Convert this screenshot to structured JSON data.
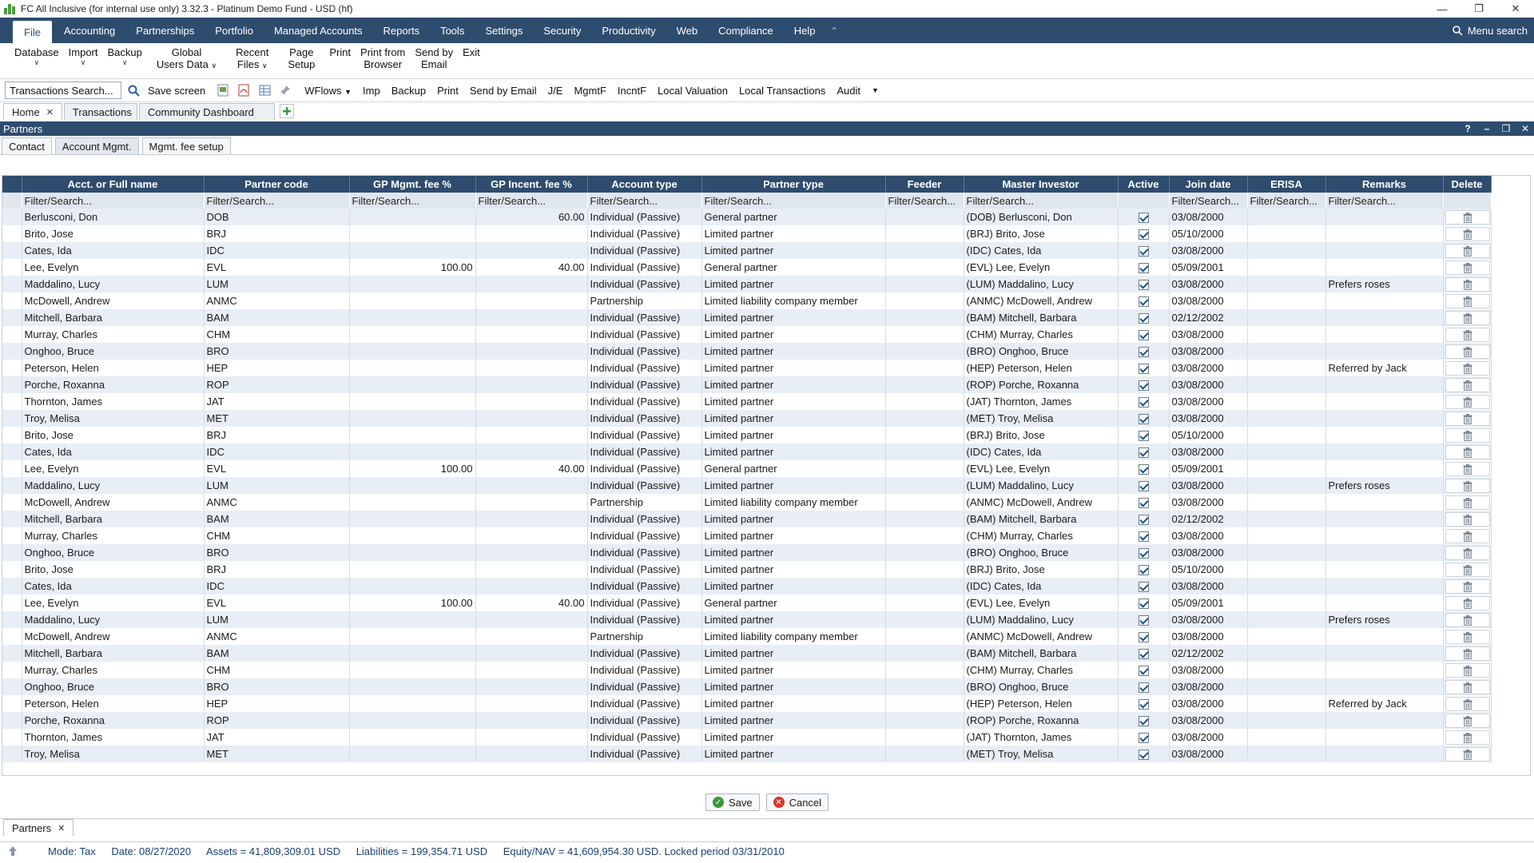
{
  "window": {
    "title": "FC All Inclusive (for internal use only) 3.32.3 - Platinum Demo Fund - USD (hf)",
    "controls": [
      "—",
      "❐",
      "✕"
    ]
  },
  "menu": {
    "items": [
      "File",
      "Accounting",
      "Partnerships",
      "Portfolio",
      "Managed Accounts",
      "Reports",
      "Tools",
      "Settings",
      "Security",
      "Productivity",
      "Web",
      "Compliance",
      "Help"
    ],
    "search_label": "Menu search"
  },
  "ribbon": {
    "items": [
      {
        "label": "Database",
        "dropdown": true
      },
      {
        "label": "Import",
        "dropdown": true
      },
      {
        "label": "Backup",
        "dropdown": true
      },
      {
        "label": "Global\nUsers Data",
        "dropdown": true
      },
      {
        "label": "Recent\nFiles",
        "dropdown": true
      },
      {
        "label": "Page\nSetup",
        "dropdown": false
      },
      {
        "label": "Print",
        "dropdown": false
      },
      {
        "label": "Print from\nBrowser",
        "dropdown": false
      },
      {
        "label": "Send by\nEmail",
        "dropdown": false
      },
      {
        "label": "Exit",
        "dropdown": false
      }
    ]
  },
  "toolbar": {
    "search_value": "Transactions Search...",
    "save_screen": "Save screen",
    "wflows": "WFlows",
    "buttons": [
      "Imp",
      "Backup",
      "Print",
      "Send by Email",
      "J/E",
      "MgmtF",
      "IncntF",
      "Local Valuation",
      "Local Transactions",
      "Audit"
    ]
  },
  "doc_tabs": [
    {
      "label": "Home",
      "closable": true,
      "active": true
    },
    {
      "label": "Transactions",
      "closable": false,
      "active": false
    },
    {
      "label": "Community Dashboard",
      "closable": false,
      "active": false
    }
  ],
  "panel": {
    "title": "Partners",
    "controls": [
      "?",
      "–",
      "❐",
      "✕"
    ]
  },
  "sub_tabs": [
    "Contact",
    "Account Mgmt.",
    "Mgmt. fee setup"
  ],
  "grid": {
    "columns": [
      "",
      "Acct. or Full name",
      "Partner code",
      "GP Mgmt. fee %",
      "GP Incent. fee %",
      "Account type",
      "Partner type",
      "Feeder",
      "Master Investor",
      "Active",
      "Join date",
      "ERISA",
      "Remarks",
      "Delete"
    ],
    "filter_placeholder": "Filter/Search...",
    "rows": [
      [
        "Berlusconi, Don",
        "DOB",
        "",
        "60.00",
        "Individual (Passive)",
        "General partner",
        "",
        "(DOB) Berlusconi, Don",
        "03/08/2000",
        "",
        ""
      ],
      [
        "Brito, Jose",
        "BRJ",
        "",
        "",
        "Individual (Passive)",
        "Limited partner",
        "",
        "(BRJ) Brito, Jose",
        "05/10/2000",
        "",
        ""
      ],
      [
        "Cates, Ida",
        "IDC",
        "",
        "",
        "Individual (Passive)",
        "Limited partner",
        "",
        "(IDC) Cates, Ida",
        "03/08/2000",
        "",
        ""
      ],
      [
        "Lee, Evelyn",
        "EVL",
        "100.00",
        "40.00",
        "Individual (Passive)",
        "General partner",
        "",
        "(EVL) Lee, Evelyn",
        "05/09/2001",
        "",
        ""
      ],
      [
        "Maddalino, Lucy",
        "LUM",
        "",
        "",
        "Individual (Passive)",
        "Limited partner",
        "",
        "(LUM) Maddalino, Lucy",
        "03/08/2000",
        "",
        "Prefers roses"
      ],
      [
        "McDowell, Andrew",
        "ANMC",
        "",
        "",
        "Partnership",
        "Limited liability company member",
        "",
        "(ANMC) McDowell, Andrew",
        "03/08/2000",
        "",
        ""
      ],
      [
        "Mitchell, Barbara",
        "BAM",
        "",
        "",
        "Individual (Passive)",
        "Limited partner",
        "",
        "(BAM) Mitchell, Barbara",
        "02/12/2002",
        "",
        ""
      ],
      [
        "Murray, Charles",
        "CHM",
        "",
        "",
        "Individual (Passive)",
        "Limited partner",
        "",
        "(CHM) Murray, Charles",
        "03/08/2000",
        "",
        ""
      ],
      [
        "Onghoo, Bruce",
        "BRO",
        "",
        "",
        "Individual (Passive)",
        "Limited partner",
        "",
        "(BRO) Onghoo, Bruce",
        "03/08/2000",
        "",
        ""
      ],
      [
        "Peterson, Helen",
        "HEP",
        "",
        "",
        "Individual (Passive)",
        "Limited partner",
        "",
        "(HEP) Peterson, Helen",
        "03/08/2000",
        "",
        "Referred by Jack"
      ],
      [
        "Porche, Roxanna",
        "ROP",
        "",
        "",
        "Individual (Passive)",
        "Limited partner",
        "",
        "(ROP) Porche, Roxanna",
        "03/08/2000",
        "",
        ""
      ],
      [
        "Thornton, James",
        "JAT",
        "",
        "",
        "Individual (Passive)",
        "Limited partner",
        "",
        "(JAT) Thornton, James",
        "03/08/2000",
        "",
        ""
      ],
      [
        "Troy, Melisa",
        "MET",
        "",
        "",
        "Individual (Passive)",
        "Limited partner",
        "",
        "(MET) Troy, Melisa",
        "03/08/2000",
        "",
        ""
      ],
      [
        "Brito, Jose",
        "BRJ",
        "",
        "",
        "Individual (Passive)",
        "Limited partner",
        "",
        "(BRJ) Brito, Jose",
        "05/10/2000",
        "",
        ""
      ],
      [
        "Cates, Ida",
        "IDC",
        "",
        "",
        "Individual (Passive)",
        "Limited partner",
        "",
        "(IDC) Cates, Ida",
        "03/08/2000",
        "",
        ""
      ],
      [
        "Lee, Evelyn",
        "EVL",
        "100.00",
        "40.00",
        "Individual (Passive)",
        "General partner",
        "",
        "(EVL) Lee, Evelyn",
        "05/09/2001",
        "",
        ""
      ],
      [
        "Maddalino, Lucy",
        "LUM",
        "",
        "",
        "Individual (Passive)",
        "Limited partner",
        "",
        "(LUM) Maddalino, Lucy",
        "03/08/2000",
        "",
        "Prefers roses"
      ],
      [
        "McDowell, Andrew",
        "ANMC",
        "",
        "",
        "Partnership",
        "Limited liability company member",
        "",
        "(ANMC) McDowell, Andrew",
        "03/08/2000",
        "",
        ""
      ],
      [
        "Mitchell, Barbara",
        "BAM",
        "",
        "",
        "Individual (Passive)",
        "Limited partner",
        "",
        "(BAM) Mitchell, Barbara",
        "02/12/2002",
        "",
        ""
      ],
      [
        "Murray, Charles",
        "CHM",
        "",
        "",
        "Individual (Passive)",
        "Limited partner",
        "",
        "(CHM) Murray, Charles",
        "03/08/2000",
        "",
        ""
      ],
      [
        "Onghoo, Bruce",
        "BRO",
        "",
        "",
        "Individual (Passive)",
        "Limited partner",
        "",
        "(BRO) Onghoo, Bruce",
        "03/08/2000",
        "",
        ""
      ],
      [
        "Brito, Jose",
        "BRJ",
        "",
        "",
        "Individual (Passive)",
        "Limited partner",
        "",
        "(BRJ) Brito, Jose",
        "05/10/2000",
        "",
        ""
      ],
      [
        "Cates, Ida",
        "IDC",
        "",
        "",
        "Individual (Passive)",
        "Limited partner",
        "",
        "(IDC) Cates, Ida",
        "03/08/2000",
        "",
        ""
      ],
      [
        "Lee, Evelyn",
        "EVL",
        "100.00",
        "40.00",
        "Individual (Passive)",
        "General partner",
        "",
        "(EVL) Lee, Evelyn",
        "05/09/2001",
        "",
        ""
      ],
      [
        "Maddalino, Lucy",
        "LUM",
        "",
        "",
        "Individual (Passive)",
        "Limited partner",
        "",
        "(LUM) Maddalino, Lucy",
        "03/08/2000",
        "",
        "Prefers roses"
      ],
      [
        "McDowell, Andrew",
        "ANMC",
        "",
        "",
        "Partnership",
        "Limited liability company member",
        "",
        "(ANMC) McDowell, Andrew",
        "03/08/2000",
        "",
        ""
      ],
      [
        "Mitchell, Barbara",
        "BAM",
        "",
        "",
        "Individual (Passive)",
        "Limited partner",
        "",
        "(BAM) Mitchell, Barbara",
        "02/12/2002",
        "",
        ""
      ],
      [
        "Murray, Charles",
        "CHM",
        "",
        "",
        "Individual (Passive)",
        "Limited partner",
        "",
        "(CHM) Murray, Charles",
        "03/08/2000",
        "",
        ""
      ],
      [
        "Onghoo, Bruce",
        "BRO",
        "",
        "",
        "Individual (Passive)",
        "Limited partner",
        "",
        "(BRO) Onghoo, Bruce",
        "03/08/2000",
        "",
        ""
      ],
      [
        "Peterson, Helen",
        "HEP",
        "",
        "",
        "Individual (Passive)",
        "Limited partner",
        "",
        "(HEP) Peterson, Helen",
        "03/08/2000",
        "",
        "Referred by Jack"
      ],
      [
        "Porche, Roxanna",
        "ROP",
        "",
        "",
        "Individual (Passive)",
        "Limited partner",
        "",
        "(ROP) Porche, Roxanna",
        "03/08/2000",
        "",
        ""
      ],
      [
        "Thornton, James",
        "JAT",
        "",
        "",
        "Individual (Passive)",
        "Limited partner",
        "",
        "(JAT) Thornton, James",
        "03/08/2000",
        "",
        ""
      ],
      [
        "Troy, Melisa",
        "MET",
        "",
        "",
        "Individual (Passive)",
        "Limited partner",
        "",
        "(MET) Troy, Melisa",
        "03/08/2000",
        "",
        ""
      ]
    ]
  },
  "actions": {
    "save": "Save",
    "cancel": "Cancel"
  },
  "bottom_tab": {
    "label": "Partners"
  },
  "status": {
    "mode": "Mode: Tax",
    "date": "Date: 08/27/2020",
    "assets": "Assets = 41,809,309.01 USD",
    "liabilities": "Liabilities = 199,354.71 USD",
    "equity": "Equity/NAV = 41,609,954.30 USD. Locked period 03/31/2010"
  },
  "colors": {
    "header_bg": "#2e4c6e",
    "row_alt": "#e8eef5",
    "filter_bg": "#dfe6ee",
    "status_text": "#1a3f75"
  }
}
